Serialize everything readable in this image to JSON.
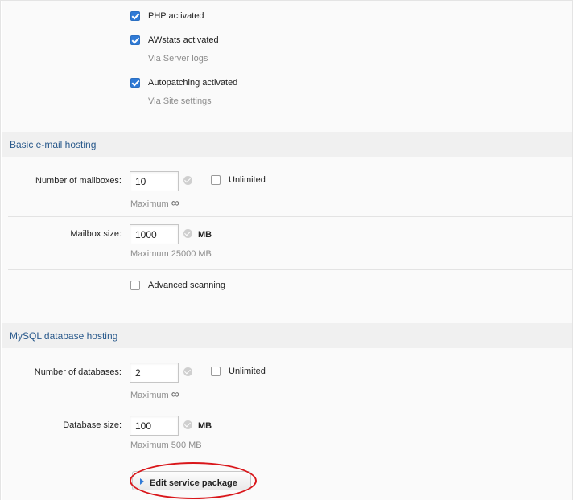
{
  "website": {
    "php": {
      "label": "PHP activated",
      "checked": true
    },
    "awstats": {
      "label": "AWstats activated",
      "checked": true,
      "hint": "Via Server logs"
    },
    "autopatching": {
      "label": "Autopatching activated",
      "checked": true,
      "hint": "Via Site settings"
    }
  },
  "email": {
    "title": "Basic e-mail hosting",
    "mailboxes": {
      "label": "Number of mailboxes:",
      "value": "10",
      "unlimited_label": "Unlimited",
      "unlimited_checked": false,
      "hint": "Maximum",
      "hint_symbol": "∞"
    },
    "mailbox_size": {
      "label": "Mailbox size:",
      "value": "1000",
      "unit": "MB",
      "hint": "Maximum 25000 MB"
    },
    "advanced_scanning": {
      "label": "Advanced scanning",
      "checked": false
    }
  },
  "mysql": {
    "title": "MySQL database hosting",
    "databases": {
      "label": "Number of databases:",
      "value": "2",
      "unlimited_label": "Unlimited",
      "unlimited_checked": false,
      "hint": "Maximum",
      "hint_symbol": "∞"
    },
    "database_size": {
      "label": "Database size:",
      "value": "100",
      "unit": "MB",
      "hint": "Maximum 500 MB"
    }
  },
  "actions": {
    "edit_label": "Edit service package"
  },
  "colors": {
    "accent": "#2f7ad6",
    "header_text": "#2a5a8c",
    "highlight": "#d9161a"
  }
}
